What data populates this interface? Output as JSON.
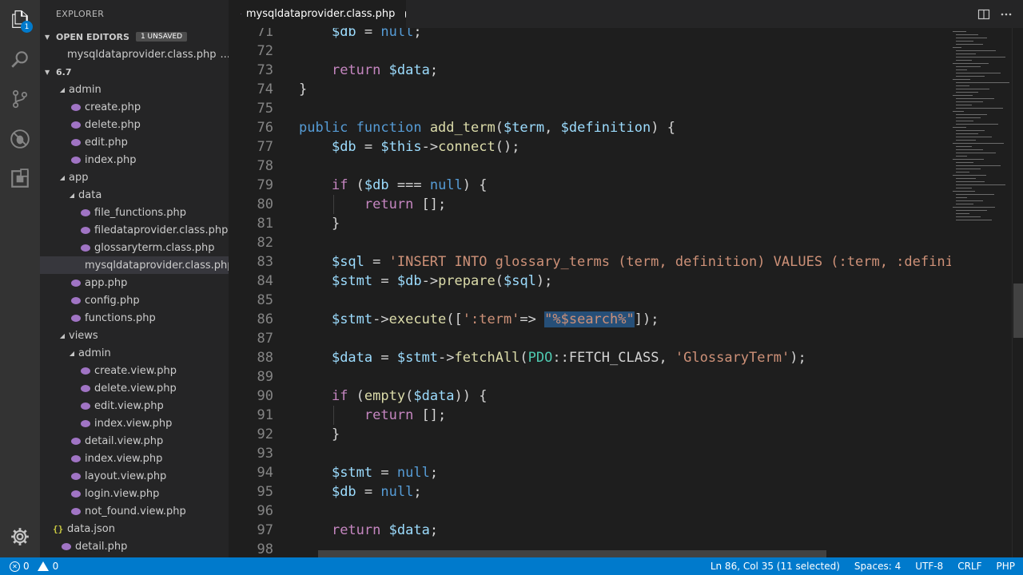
{
  "activity_bar": {
    "explorer_badge": "1",
    "icons": [
      "files-icon",
      "search-icon",
      "source-control-icon",
      "debug-icon",
      "extensions-icon",
      "settings-gear-icon"
    ]
  },
  "sidebar": {
    "title": "EXPLORER",
    "open_editors": {
      "label": "OPEN EDITORS",
      "badge": "1 UNSAVED",
      "files": [
        {
          "name": "mysqldataprovider.class.php",
          "ellipsis": "..."
        }
      ]
    },
    "root_folder": "6.7",
    "tree": [
      {
        "label": "admin",
        "type": "folder",
        "depth": 1
      },
      {
        "label": "create.php",
        "type": "php",
        "depth": 2
      },
      {
        "label": "delete.php",
        "type": "php",
        "depth": 2
      },
      {
        "label": "edit.php",
        "type": "php",
        "depth": 2
      },
      {
        "label": "index.php",
        "type": "php",
        "depth": 2
      },
      {
        "label": "app",
        "type": "folder",
        "depth": 1
      },
      {
        "label": "data",
        "type": "folder",
        "depth": 2
      },
      {
        "label": "file_functions.php",
        "type": "php",
        "depth": 3
      },
      {
        "label": "filedataprovider.class.php",
        "type": "php",
        "depth": 3
      },
      {
        "label": "glossaryterm.class.php",
        "type": "php",
        "depth": 3
      },
      {
        "label": "mysqldataprovider.class.php",
        "type": "php",
        "depth": 3,
        "selected": true
      },
      {
        "label": "app.php",
        "type": "php",
        "depth": 2
      },
      {
        "label": "config.php",
        "type": "php",
        "depth": 2
      },
      {
        "label": "functions.php",
        "type": "php",
        "depth": 2
      },
      {
        "label": "views",
        "type": "folder",
        "depth": 1
      },
      {
        "label": "admin",
        "type": "folder",
        "depth": 2
      },
      {
        "label": "create.view.php",
        "type": "php",
        "depth": 3
      },
      {
        "label": "delete.view.php",
        "type": "php",
        "depth": 3
      },
      {
        "label": "edit.view.php",
        "type": "php",
        "depth": 3
      },
      {
        "label": "index.view.php",
        "type": "php",
        "depth": 3
      },
      {
        "label": "detail.view.php",
        "type": "php",
        "depth": 2
      },
      {
        "label": "index.view.php",
        "type": "php",
        "depth": 2
      },
      {
        "label": "layout.view.php",
        "type": "php",
        "depth": 2
      },
      {
        "label": "login.view.php",
        "type": "php",
        "depth": 2
      },
      {
        "label": "not_found.view.php",
        "type": "php",
        "depth": 2
      },
      {
        "label": "data.json",
        "type": "json",
        "depth": 1
      },
      {
        "label": "detail.php",
        "type": "php",
        "depth": 1
      }
    ]
  },
  "tab": {
    "label": "mysqldataprovider.class.php"
  },
  "editor": {
    "lines": [
      {
        "n": "71",
        "guide": false,
        "tokens": [
          [
            "p",
            "    "
          ],
          [
            "v",
            "$db"
          ],
          [
            "p",
            " = "
          ],
          [
            "k",
            "null"
          ],
          [
            "p",
            ";"
          ]
        ]
      },
      {
        "n": "72",
        "guide": false,
        "tokens": []
      },
      {
        "n": "73",
        "guide": false,
        "tokens": [
          [
            "p",
            "    "
          ],
          [
            "c",
            "return"
          ],
          [
            "p",
            " "
          ],
          [
            "v",
            "$data"
          ],
          [
            "p",
            ";"
          ]
        ]
      },
      {
        "n": "74",
        "guide": false,
        "tokens": [
          [
            "p",
            "}"
          ]
        ]
      },
      {
        "n": "75",
        "guide": false,
        "tokens": []
      },
      {
        "n": "76",
        "guide": false,
        "tokens": [
          [
            "k",
            "public"
          ],
          [
            "p",
            " "
          ],
          [
            "k",
            "function"
          ],
          [
            "p",
            " "
          ],
          [
            "f",
            "add_term"
          ],
          [
            "p",
            "("
          ],
          [
            "v",
            "$term"
          ],
          [
            "p",
            ", "
          ],
          [
            "v",
            "$definition"
          ],
          [
            "p",
            ") {"
          ]
        ]
      },
      {
        "n": "77",
        "guide": false,
        "tokens": [
          [
            "p",
            "    "
          ],
          [
            "v",
            "$db"
          ],
          [
            "p",
            " = "
          ],
          [
            "v",
            "$this"
          ],
          [
            "p",
            "->"
          ],
          [
            "f",
            "connect"
          ],
          [
            "p",
            "();"
          ]
        ]
      },
      {
        "n": "78",
        "guide": false,
        "tokens": []
      },
      {
        "n": "79",
        "guide": false,
        "tokens": [
          [
            "p",
            "    "
          ],
          [
            "c",
            "if"
          ],
          [
            "p",
            " ("
          ],
          [
            "v",
            "$db"
          ],
          [
            "p",
            " === "
          ],
          [
            "k",
            "null"
          ],
          [
            "p",
            ") {"
          ]
        ]
      },
      {
        "n": "80",
        "guide": true,
        "tokens": [
          [
            "p",
            "        "
          ],
          [
            "c",
            "return"
          ],
          [
            "p",
            " [];"
          ]
        ]
      },
      {
        "n": "81",
        "guide": false,
        "tokens": [
          [
            "p",
            "    }"
          ]
        ]
      },
      {
        "n": "82",
        "guide": false,
        "tokens": []
      },
      {
        "n": "83",
        "guide": false,
        "tokens": [
          [
            "p",
            "    "
          ],
          [
            "v",
            "$sql"
          ],
          [
            "p",
            " = "
          ],
          [
            "s",
            "'INSERT INTO glossary_terms (term, definition) VALUES (:term, :definition)'"
          ],
          [
            "p",
            ";"
          ]
        ]
      },
      {
        "n": "84",
        "guide": false,
        "tokens": [
          [
            "p",
            "    "
          ],
          [
            "v",
            "$stmt"
          ],
          [
            "p",
            " = "
          ],
          [
            "v",
            "$db"
          ],
          [
            "p",
            "->"
          ],
          [
            "f",
            "prepare"
          ],
          [
            "p",
            "("
          ],
          [
            "v",
            "$sql"
          ],
          [
            "p",
            ");"
          ]
        ]
      },
      {
        "n": "85",
        "guide": false,
        "tokens": []
      },
      {
        "n": "86",
        "guide": false,
        "tokens": [
          [
            "p",
            "    "
          ],
          [
            "v",
            "$stmt"
          ],
          [
            "p",
            "->"
          ],
          [
            "f",
            "execute"
          ],
          [
            "p",
            "(["
          ],
          [
            "s",
            "':term'"
          ],
          [
            "p",
            "=> "
          ],
          [
            "cursor",
            ""
          ],
          [
            "sel",
            "\"%$search%\""
          ],
          [
            "p",
            "]);"
          ]
        ]
      },
      {
        "n": "87",
        "guide": false,
        "tokens": []
      },
      {
        "n": "88",
        "guide": false,
        "tokens": [
          [
            "p",
            "    "
          ],
          [
            "v",
            "$data"
          ],
          [
            "p",
            " = "
          ],
          [
            "v",
            "$stmt"
          ],
          [
            "p",
            "->"
          ],
          [
            "f",
            "fetchAll"
          ],
          [
            "p",
            "("
          ],
          [
            "t",
            "PDO"
          ],
          [
            "p",
            "::FETCH_CLASS, "
          ],
          [
            "s",
            "'GlossaryTerm'"
          ],
          [
            "p",
            ");"
          ]
        ]
      },
      {
        "n": "89",
        "guide": false,
        "tokens": []
      },
      {
        "n": "90",
        "guide": false,
        "tokens": [
          [
            "p",
            "    "
          ],
          [
            "c",
            "if"
          ],
          [
            "p",
            " ("
          ],
          [
            "f",
            "empty"
          ],
          [
            "p",
            "("
          ],
          [
            "v",
            "$data"
          ],
          [
            "p",
            ")) {"
          ]
        ]
      },
      {
        "n": "91",
        "guide": true,
        "tokens": [
          [
            "p",
            "        "
          ],
          [
            "c",
            "return"
          ],
          [
            "p",
            " [];"
          ]
        ]
      },
      {
        "n": "92",
        "guide": false,
        "tokens": [
          [
            "p",
            "    }"
          ]
        ]
      },
      {
        "n": "93",
        "guide": false,
        "tokens": []
      },
      {
        "n": "94",
        "guide": false,
        "tokens": [
          [
            "p",
            "    "
          ],
          [
            "v",
            "$stmt"
          ],
          [
            "p",
            " = "
          ],
          [
            "k",
            "null"
          ],
          [
            "p",
            ";"
          ]
        ]
      },
      {
        "n": "95",
        "guide": false,
        "tokens": [
          [
            "p",
            "    "
          ],
          [
            "v",
            "$db"
          ],
          [
            "p",
            " = "
          ],
          [
            "k",
            "null"
          ],
          [
            "p",
            ";"
          ]
        ]
      },
      {
        "n": "96",
        "guide": false,
        "tokens": []
      },
      {
        "n": "97",
        "guide": false,
        "tokens": [
          [
            "p",
            "    "
          ],
          [
            "c",
            "return"
          ],
          [
            "p",
            " "
          ],
          [
            "v",
            "$data"
          ],
          [
            "p",
            ";"
          ]
        ]
      },
      {
        "n": "98",
        "guide": false,
        "tokens": []
      }
    ]
  },
  "status_bar": {
    "errors": "0",
    "warnings": "0",
    "position": "Ln 86, Col 35 (11 selected)",
    "spaces": "Spaces: 4",
    "encoding": "UTF-8",
    "eol": "CRLF",
    "language": "PHP"
  },
  "colors": {
    "accent": "#007acc",
    "php_icon": "#a074c4",
    "selection": "#264f78"
  }
}
